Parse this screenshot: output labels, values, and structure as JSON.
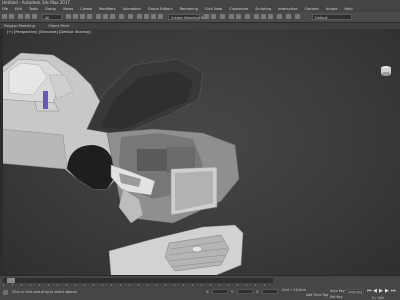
{
  "window": {
    "title": "Untitled - Autodesk 3ds Max 2017"
  },
  "menu": {
    "items": [
      "File",
      "Edit",
      "Tools",
      "Group",
      "Views",
      "Create",
      "Modifiers",
      "Animation",
      "Graph Editors",
      "Rendering",
      "Civil View",
      "Customize",
      "Scripting",
      "Interactive",
      "Content",
      "Arnold",
      "Help"
    ]
  },
  "toolbar": {
    "selection_filter": "All",
    "selection_set": "Create Selection Se",
    "workspace": "Default"
  },
  "ribbon": {
    "left_text": "Polygon Modeling",
    "mid_text": "Object Paint"
  },
  "viewport": {
    "label": "[+] [Perspective] [Standard] [Default Shading]"
  },
  "status": {
    "frame_counter": "0 / 100",
    "x_label": "X:",
    "y_label": "Y:",
    "z_label": "Z:",
    "grid": "Grid = 10,0cm",
    "add_time_tag": "Add Time Tag",
    "autokey": "Auto Key",
    "setkey": "Set Key",
    "selected": "Selected",
    "message": "Click or click-and-drag to select objects"
  },
  "colors": {
    "accent": "#1e90ff",
    "viewport_bg": "#3b3b3b",
    "panel": "#464646"
  }
}
